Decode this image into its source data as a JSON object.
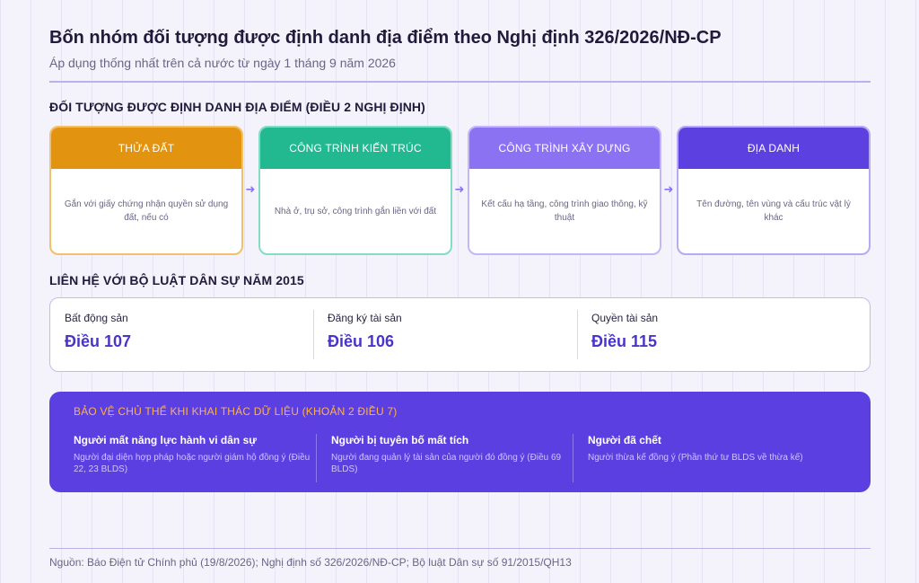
{
  "header": {
    "title": "Bốn nhóm đối tượng được định danh địa điểm theo Nghị định 326/2026/NĐ-CP",
    "subtitle": "Áp dụng thống nhất trên cả nước từ ngày 1 tháng 9 năm 2026"
  },
  "objects": {
    "heading": "ĐỐI TƯỢNG ĐƯỢC ĐỊNH DANH ĐỊA ĐIỂM (ĐIỀU 2 NGHỊ ĐỊNH)",
    "cards": [
      {
        "title": "THỬA ĐẤT",
        "desc": "Gắn với giấy chứng nhận quyền sử dụng đất, nếu có",
        "color": "#e29410"
      },
      {
        "title": "CÔNG TRÌNH KIẾN TRÚC",
        "desc": "Nhà ở, trụ sở, công trình gắn liền với đất",
        "color": "#22b890"
      },
      {
        "title": "CÔNG TRÌNH XÂY DỰNG",
        "desc": "Kết cấu hạ tầng, công trình giao thông, kỹ thuật",
        "color": "#8a72f3"
      },
      {
        "title": "ĐỊA DANH",
        "desc": "Tên đường, tên vùng và cấu trúc vật lý khác",
        "color": "#5d40e0"
      }
    ],
    "arrow_icon": "arrow-right-icon"
  },
  "civil_code": {
    "heading": "LIÊN HỆ VỚI BỘ LUẬT DÂN SỰ NĂM 2015",
    "items": [
      {
        "label": "Bất động sản",
        "value": "Điều 107"
      },
      {
        "label": "Đăng ký tài sản",
        "value": "Điều 106"
      },
      {
        "label": "Quyền tài sản",
        "value": "Điều 115"
      }
    ]
  },
  "protection": {
    "heading": "BẢO VỆ CHỦ THỂ KHI KHAI THÁC DỮ LIỆU (KHOẢN 2 ĐIỀU 7)",
    "items": [
      {
        "title": "Người mất năng lực hành vi dân sự",
        "desc": "Người đại diện hợp pháp hoặc người giám hộ đồng ý (Điều 22, 23 BLDS)"
      },
      {
        "title": "Người bị tuyên bố mất tích",
        "desc": "Người đang quản lý tài sản của người đó đồng ý (Điều 69 BLDS)"
      },
      {
        "title": "Người đã chết",
        "desc": "Người thừa kế đồng ý (Phần thứ tư BLDS về thừa kế)"
      }
    ]
  },
  "footer": {
    "source": "Nguồn: Báo Điện tử Chính phủ (19/8/2026); Nghị định số 326/2026/NĐ-CP; Bộ luật Dân sự số 91/2015/QH13"
  }
}
